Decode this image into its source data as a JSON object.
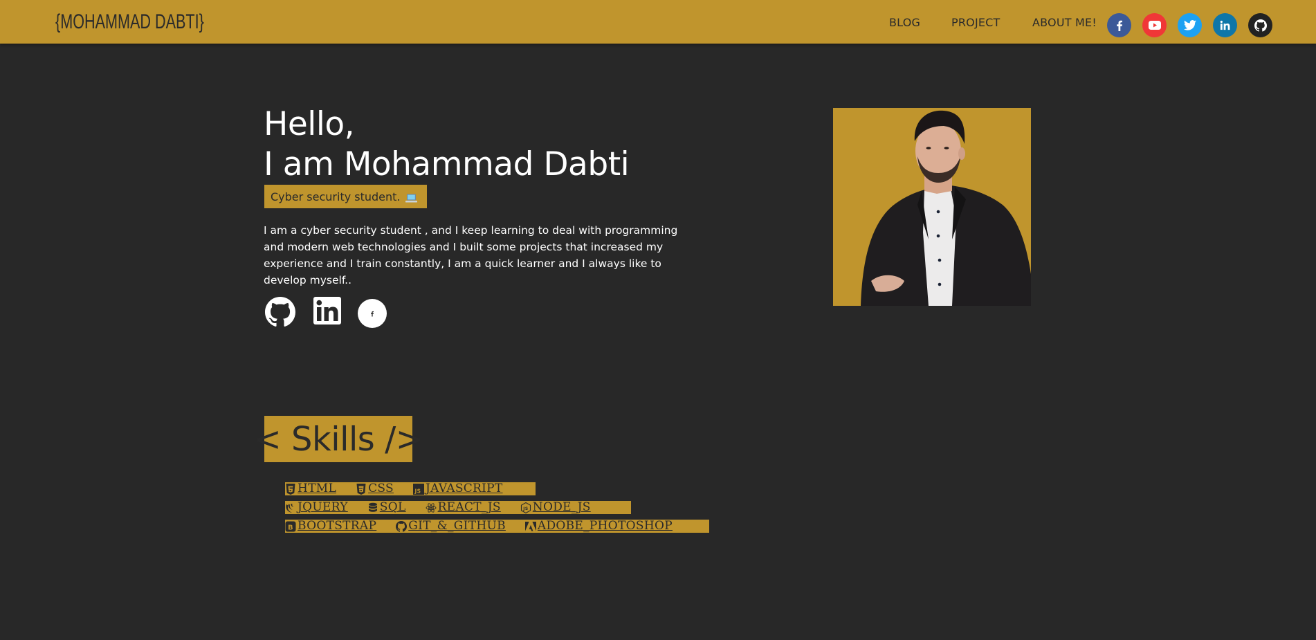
{
  "navbar": {
    "brand": "{MOHAMMAD DABTI}",
    "links": [
      "BLOG",
      "PROJECT",
      "ABOUT ME!"
    ],
    "social": [
      {
        "icon": "facebook-icon",
        "color": "#3b5998"
      },
      {
        "icon": "youtube-icon",
        "color": "#f03737"
      },
      {
        "icon": "twitter-icon",
        "color": "#1da1f2"
      },
      {
        "icon": "linkedin-icon",
        "color": "#0e76a8"
      },
      {
        "icon": "github-icon",
        "color": "#222222"
      }
    ]
  },
  "hero": {
    "greeting": "Hello,",
    "name": "I am Mohammad Dabti",
    "role": "Cyber security student.",
    "bio": "I am a cyber security student , and I keep learning to deal with programming and modern web technologies and I built some projects that increased my experience and I train constantly, I am a quick learner and I always like to develop myself..",
    "social": [
      "github-icon",
      "linkedin-icon",
      "facebook-icon"
    ]
  },
  "skills": {
    "title": "< Skills />",
    "rows": [
      [
        {
          "label": "HTML",
          "icon": "html5-icon"
        },
        {
          "label": "CSS",
          "icon": "css3-icon"
        },
        {
          "label": "JAVASCRIPT",
          "icon": "javascript-icon"
        }
      ],
      [
        {
          "label": "JQUERY",
          "icon": "jquery-icon"
        },
        {
          "label": "SQL",
          "icon": "database-icon"
        },
        {
          "label": "REACT_JS",
          "icon": "react-icon"
        },
        {
          "label": "NODE_JS",
          "icon": "nodejs-icon"
        }
      ],
      [
        {
          "label": "BOOTSTRAP",
          "icon": "bootstrap-icon"
        },
        {
          "label": "GIT_&_GITHUB",
          "icon": "github-icon"
        },
        {
          "label": "ADOBE_PHOTOSHOP",
          "icon": "adobe-icon"
        }
      ]
    ]
  },
  "colors": {
    "accent": "#c0952d",
    "background": "#282828",
    "text_dark": "#2a2a2a",
    "text_light": "#ffffff"
  }
}
